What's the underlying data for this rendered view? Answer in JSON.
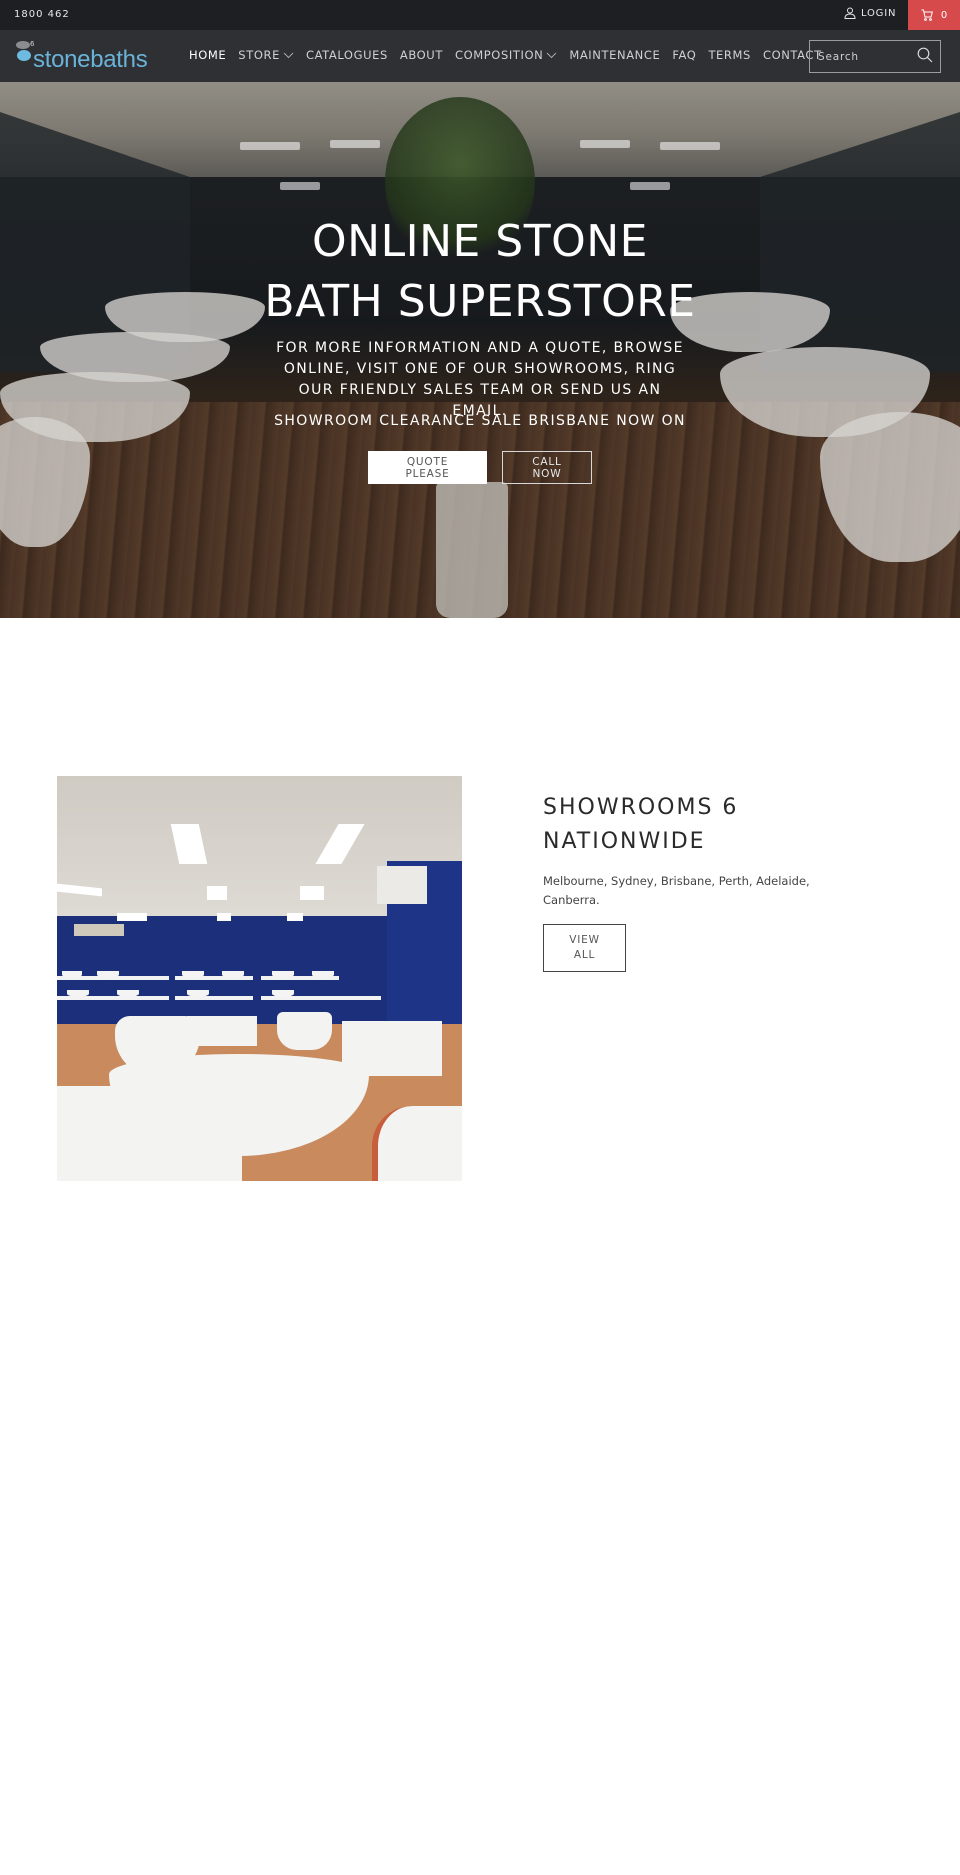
{
  "topbar": {
    "phone": "1800 462",
    "login_label": "LOGIN",
    "cart_count": "0",
    "cart_color": "#d64a4c"
  },
  "header": {
    "logo_text": "stonebaths",
    "logo_badge": "6",
    "nav": [
      {
        "label": "HOME",
        "active": true,
        "dropdown": false
      },
      {
        "label": "STORE",
        "active": false,
        "dropdown": true
      },
      {
        "label": "CATALOGUES",
        "active": false,
        "dropdown": false
      },
      {
        "label": "ABOUT",
        "active": false,
        "dropdown": false
      },
      {
        "label": "COMPOSITION",
        "active": false,
        "dropdown": true
      },
      {
        "label": "MAINTENANCE",
        "active": false,
        "dropdown": false
      },
      {
        "label": "FAQ",
        "active": false,
        "dropdown": false
      },
      {
        "label": "TERMS",
        "active": false,
        "dropdown": false
      },
      {
        "label": "CONTACT",
        "active": false,
        "dropdown": false
      }
    ],
    "search": {
      "placeholder": "Search",
      "value": ""
    }
  },
  "hero": {
    "title_line1": "ONLINE STONE",
    "title_line2": "BATH SUPERSTORE",
    "subtitle": "FOR MORE INFORMATION AND A QUOTE, BROWSE ONLINE, VISIT ONE OF OUR SHOWROOMS, RING OUR FRIENDLY SALES TEAM OR SEND US AN EMAIL.",
    "sale_text": "SHOWROOM CLEARANCE SALE BRISBANE NOW ON",
    "quote_button_line1": "QUOTE",
    "quote_button_line2": "PLEASE",
    "call_button_line1": "CALL",
    "call_button_line2": "NOW"
  },
  "showrooms": {
    "title_line1": "SHOWROOMS 6",
    "title_line2": "NATIONWIDE",
    "cities": "Melbourne, Sydney, Brisbane, Perth, Adelaide, Canberra.",
    "button_line1": "VIEW",
    "button_line2": "ALL"
  },
  "icons": {
    "login": "user-icon",
    "cart": "cart-icon",
    "search": "search-icon",
    "dropdown": "chevron-down-icon"
  }
}
